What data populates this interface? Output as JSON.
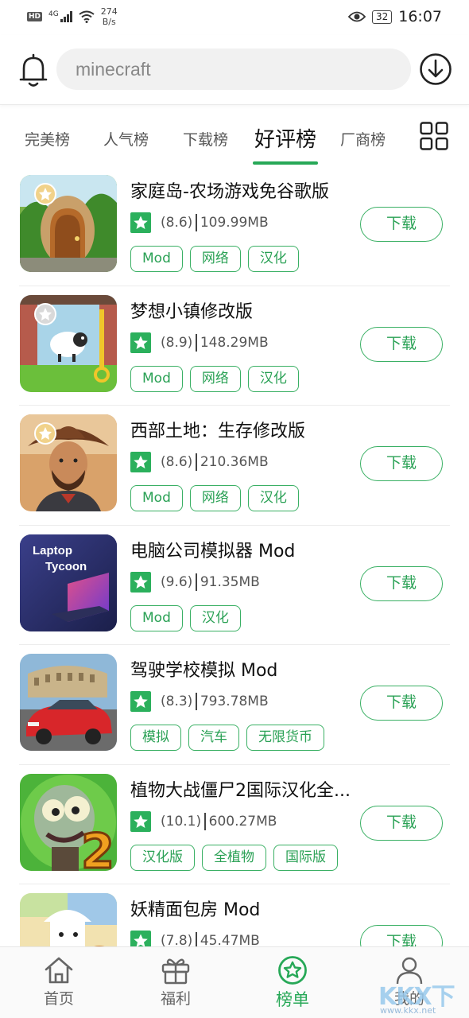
{
  "status_bar": {
    "hd": "HD",
    "network": "4G",
    "speed_value": "274",
    "speed_unit": "B/s",
    "battery": "32",
    "time": "16:07"
  },
  "header": {
    "search_text": "minecraft",
    "icons": [
      "bell-icon",
      "download-circle-icon"
    ]
  },
  "tabs": [
    "完美榜",
    "人气榜",
    "下载榜",
    "好评榜",
    "厂商榜"
  ],
  "active_tab": "好评榜",
  "accent_color": "#27a857",
  "download_label": "下载",
  "apps": [
    {
      "name": "家庭岛-农场游戏免谷歌版",
      "rating": "(8.6)",
      "size": "109.99MB",
      "tags": [
        "Mod",
        "网络",
        "汉化"
      ]
    },
    {
      "name": "梦想小镇修改版",
      "rating": "(8.9)",
      "size": "148.29MB",
      "tags": [
        "Mod",
        "网络",
        "汉化"
      ]
    },
    {
      "name": "西部土地：生存修改版",
      "rating": "(8.6)",
      "size": "210.36MB",
      "tags": [
        "Mod",
        "网络",
        "汉化"
      ]
    },
    {
      "name": "电脑公司模拟器 Mod",
      "rating": "(9.6)",
      "size": "91.35MB",
      "tags": [
        "Mod",
        "汉化"
      ],
      "thumb_text_1": "Laptop",
      "thumb_text_2": "Tycoon"
    },
    {
      "name": "驾驶学校模拟 Mod",
      "rating": "(8.3)",
      "size": "793.78MB",
      "tags": [
        "模拟",
        "汽车",
        "无限货币"
      ]
    },
    {
      "name": "植物大战僵尸2国际汉化全...",
      "rating": "(10.1)",
      "size": "600.27MB",
      "tags": [
        "汉化版",
        "全植物",
        "国际版"
      ]
    },
    {
      "name": "妖精面包房 Mod",
      "rating": "(7.8)",
      "size": "45.47MB",
      "tags": []
    }
  ],
  "bottom_nav": [
    {
      "label": "首页",
      "icon": "home-icon"
    },
    {
      "label": "福利",
      "icon": "gift-icon"
    },
    {
      "label": "榜单",
      "icon": "star-badge-icon",
      "active": true
    },
    {
      "label": "我的",
      "icon": "user-icon"
    }
  ],
  "watermark": {
    "text": "KKX下载",
    "url": "www.kkx.net"
  }
}
